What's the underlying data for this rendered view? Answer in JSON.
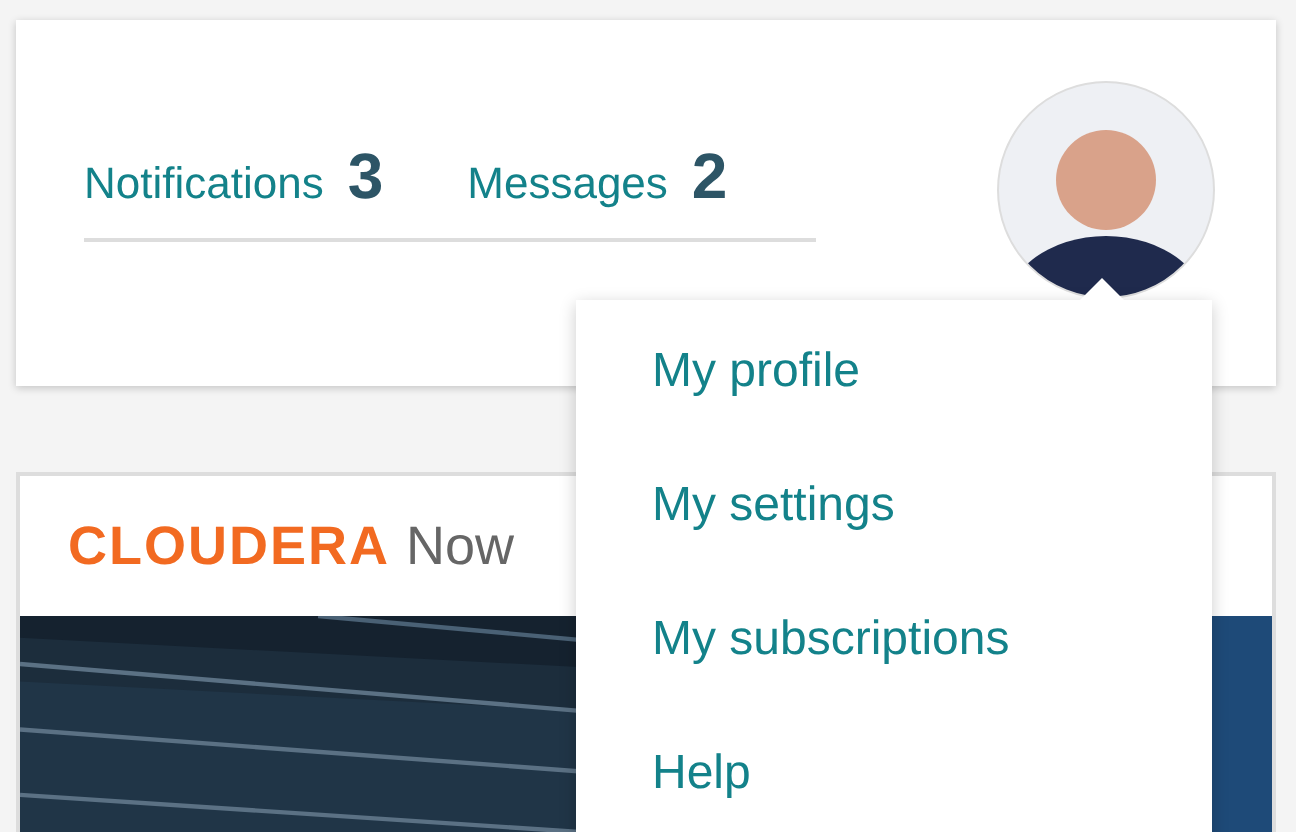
{
  "header": {
    "counters": [
      {
        "label": "Notifications",
        "count": "3"
      },
      {
        "label": "Messages",
        "count": "2"
      }
    ]
  },
  "user_menu": {
    "expanded": true,
    "items": [
      {
        "label": "My profile"
      },
      {
        "label": "My settings"
      },
      {
        "label": "My subscriptions"
      },
      {
        "label": "Help"
      }
    ]
  },
  "banner": {
    "brand": "CLOUDERA",
    "suffix": "Now"
  }
}
